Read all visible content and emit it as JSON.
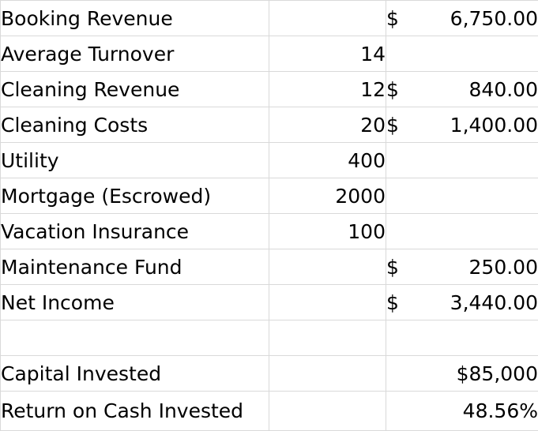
{
  "rows": [
    {
      "label": "Booking Revenue",
      "b": "",
      "c_currency": "$",
      "c_amount": "6,750.00"
    },
    {
      "label": "Average Turnover",
      "b": "14",
      "c_currency": "",
      "c_amount": ""
    },
    {
      "label": "Cleaning Revenue",
      "b": "12",
      "c_currency": "$",
      "c_amount": "840.00"
    },
    {
      "label": "Cleaning Costs",
      "b": "20",
      "c_currency": "$",
      "c_amount": "1,400.00"
    },
    {
      "label": "Utility",
      "b": "400",
      "c_currency": "",
      "c_amount": ""
    },
    {
      "label": "Mortgage (Escrowed)",
      "b": "2000",
      "c_currency": "",
      "c_amount": ""
    },
    {
      "label": "Vacation Insurance",
      "b": "100",
      "c_currency": "",
      "c_amount": ""
    },
    {
      "label": "Maintenance Fund",
      "b": "",
      "c_currency": "$",
      "c_amount": "250.00"
    },
    {
      "label": "Net Income",
      "b": "",
      "c_currency": "$",
      "c_amount": "3,440.00"
    },
    {
      "label": "",
      "b": "",
      "c_currency": "",
      "c_amount": ""
    },
    {
      "label": "Capital Invested",
      "b": "",
      "c_value": "$85,000"
    },
    {
      "label": "Return on Cash Invested",
      "b": "",
      "c_value": "48.56%"
    }
  ]
}
